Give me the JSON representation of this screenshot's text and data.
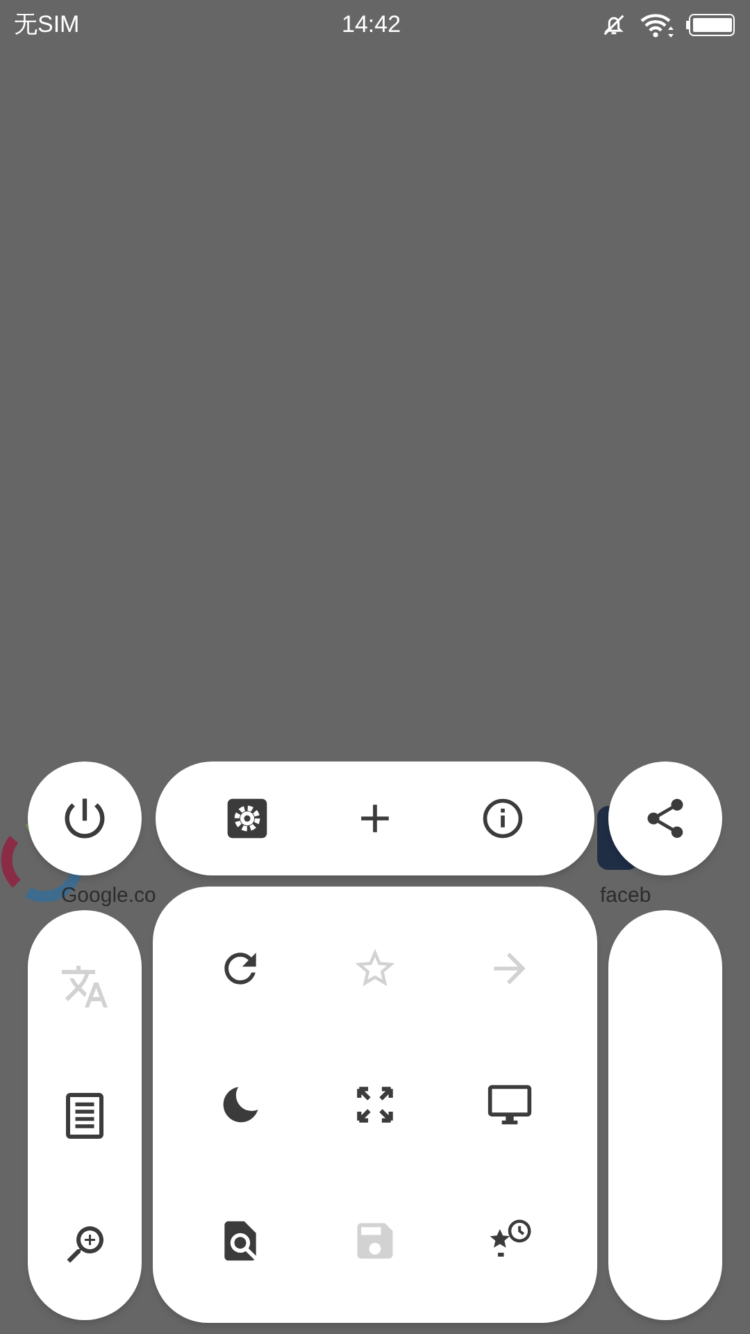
{
  "status_bar": {
    "carrier": "无SIM",
    "time": "14:42"
  },
  "background_sites": [
    {
      "label": "Google.co"
    },
    {
      "label": "faceb"
    }
  ],
  "menu": {
    "left_button": {
      "kind": "power",
      "disabled": false
    },
    "top_bar": [
      {
        "kind": "settings",
        "disabled": false
      },
      {
        "kind": "add",
        "disabled": false
      },
      {
        "kind": "info",
        "disabled": false
      }
    ],
    "right_button": {
      "kind": "share",
      "disabled": false
    },
    "left_column": [
      {
        "kind": "translate",
        "disabled": true
      },
      {
        "kind": "reader",
        "disabled": false
      },
      {
        "kind": "zoom",
        "disabled": false
      }
    ],
    "grid": [
      {
        "kind": "refresh",
        "disabled": false
      },
      {
        "kind": "star",
        "disabled": true
      },
      {
        "kind": "forward",
        "disabled": true
      },
      {
        "kind": "night",
        "disabled": false
      },
      {
        "kind": "fullscreen",
        "disabled": false
      },
      {
        "kind": "desktop",
        "disabled": false
      },
      {
        "kind": "find",
        "disabled": false
      },
      {
        "kind": "save",
        "disabled": true
      },
      {
        "kind": "bookmarks_history",
        "disabled": false
      }
    ]
  }
}
